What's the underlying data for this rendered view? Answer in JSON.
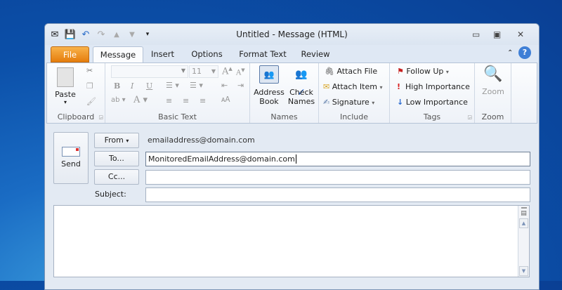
{
  "window": {
    "title": "Untitled  -  Message (HTML)"
  },
  "tabs": [
    {
      "label": "File"
    },
    {
      "label": "Message"
    },
    {
      "label": "Insert"
    },
    {
      "label": "Options"
    },
    {
      "label": "Format Text"
    },
    {
      "label": "Review"
    }
  ],
  "ribbon": {
    "clipboard": {
      "label": "Clipboard",
      "paste": "Paste"
    },
    "basic_text": {
      "label": "Basic Text",
      "font_size": "11",
      "bold": "B",
      "italic": "I",
      "underline": "U"
    },
    "names": {
      "label": "Names",
      "address_book_1": "Address",
      "address_book_2": "Book",
      "check_names_1": "Check",
      "check_names_2": "Names"
    },
    "include": {
      "label": "Include",
      "attach_file": "Attach File",
      "attach_item": "Attach Item",
      "signature": "Signature"
    },
    "tags": {
      "label": "Tags",
      "follow_up": "Follow Up",
      "high_importance": "High Importance",
      "low_importance": "Low Importance"
    },
    "zoom": {
      "label": "Zoom",
      "zoom_button": "Zoom"
    }
  },
  "compose": {
    "send": "Send",
    "from_button": "From",
    "from_value": "emailaddress@domain.com",
    "to_button": "To...",
    "to_value": "MonitoredEmailAddress@domain.com",
    "cc_button": "Cc...",
    "cc_value": "",
    "subject_label": "Subject:",
    "subject_value": "",
    "body": ""
  }
}
